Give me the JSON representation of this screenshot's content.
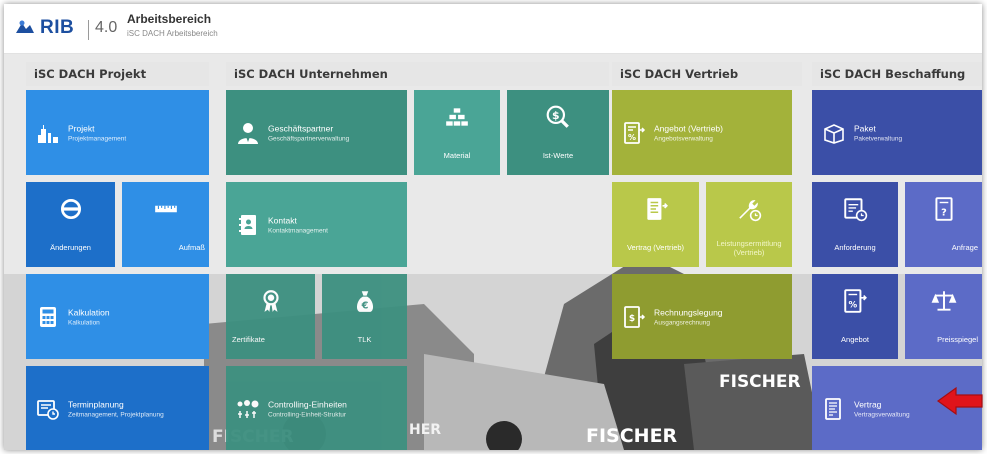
{
  "header": {
    "logo_text": "RIB",
    "version": "4.0",
    "title": "Arbeitsbereich",
    "subtitle": "iSC DACH Arbeitsbereich"
  },
  "background_text": {
    "fischer_1": "FISCHER",
    "fischer_2": "FISCHER",
    "fischer_3": "FISCHER",
    "her": "HER"
  },
  "groups": [
    {
      "name": "iSC DACH Projekt"
    },
    {
      "name": "iSC DACH Unternehmen"
    },
    {
      "name": "iSC DACH Vertrieb"
    },
    {
      "name": "iSC DACH Beschaffung"
    }
  ],
  "tiles": {
    "projekt": {
      "title": "Projekt",
      "sub": "Projektmanagement",
      "icon": "skyline-icon"
    },
    "aenderungen": {
      "title": "Änderungen",
      "icon": "change-icon"
    },
    "aufmass": {
      "title": "Aufmaß",
      "icon": "ruler-icon"
    },
    "kalkulation": {
      "title": "Kalkulation",
      "sub": "Kalkulation",
      "icon": "calculator-icon"
    },
    "terminplanung": {
      "title": "Terminplanung",
      "sub": "Zeitmanagement, Projektplanung",
      "icon": "schedule-icon"
    },
    "geschaeftspartner": {
      "title": "Geschäftspartner",
      "sub": "Geschäftspartnerverwaltung",
      "icon": "person-icon"
    },
    "material": {
      "title": "Material",
      "icon": "bricks-icon"
    },
    "istwerte": {
      "title": "Ist-Werte",
      "icon": "money-search-icon"
    },
    "kontakt": {
      "title": "Kontakt",
      "sub": "Kontaktmanagement",
      "icon": "contact-book-icon"
    },
    "zertifikate": {
      "title": "Zertifikate",
      "icon": "award-icon"
    },
    "tlk": {
      "title": "TLK",
      "icon": "money-bag-icon"
    },
    "controlling": {
      "title": "Controlling-Einheiten",
      "sub": "Controlling-Einheit-Struktur",
      "icon": "structure-icon"
    },
    "angebot_vertrieb": {
      "title": "Angebot (Vertrieb)",
      "sub": "Angebotsverwaltung",
      "icon": "percent-doc-icon"
    },
    "vertrag_vertrieb": {
      "title": "Vertrag (Vertrieb)",
      "icon": "contract-doc-icon"
    },
    "leistung": {
      "title": "Leistungsermittlung (Vertrieb)",
      "icon": "wrench-clock-icon"
    },
    "rechnung": {
      "title": "Rechnungslegung",
      "sub": "Ausgangsrechnung",
      "icon": "invoice-icon"
    },
    "paket": {
      "title": "Paket",
      "sub": "Paketverwaltung",
      "icon": "package-icon"
    },
    "anforderung": {
      "title": "Anforderung",
      "icon": "request-icon"
    },
    "anfrage": {
      "title": "Anfrage",
      "icon": "inquiry-doc-icon"
    },
    "angebot": {
      "title": "Angebot",
      "icon": "percent-doc-icon"
    },
    "preisspiegel": {
      "title": "Preisspiegel",
      "icon": "scales-icon"
    },
    "vertrag": {
      "title": "Vertrag",
      "sub": "Vertragsverwaltung",
      "icon": "contract-icon"
    }
  },
  "colors": {
    "projekt": "#2f8fe6",
    "unternehmen": "#3d9080",
    "vertrieb": "#a3b23a",
    "beschaffung": "#3b4fa7",
    "annotation_arrow": "#e0141b"
  }
}
